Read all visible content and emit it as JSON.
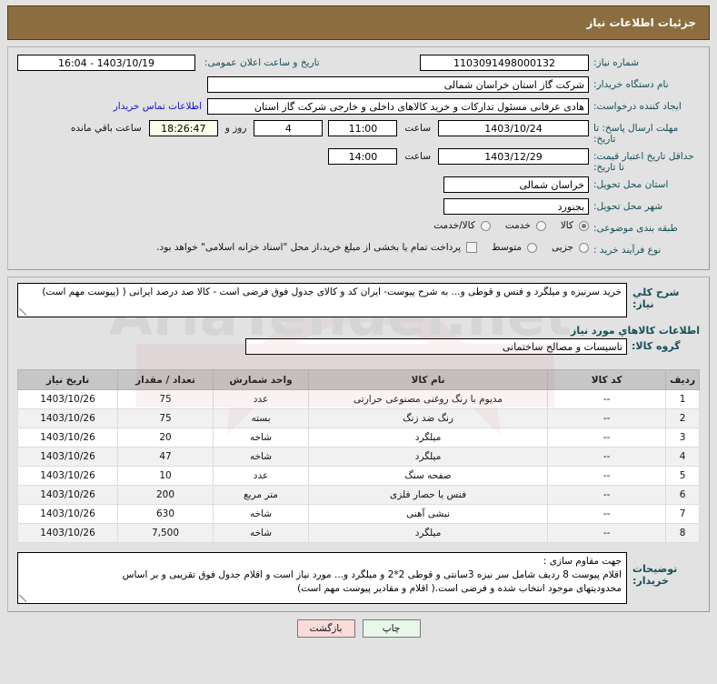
{
  "header": {
    "title": "جزئیات اطلاعات نیاز"
  },
  "form": {
    "need_number": {
      "label": "شماره نیاز:",
      "value": "1103091498000132"
    },
    "public_announce": {
      "label": "تاریخ و ساعت اعلان عمومی:",
      "value": "1403/10/19 - 16:04"
    },
    "buyer_org": {
      "label": "نام دستگاه خریدار:",
      "value": "شرکت گاز استان خراسان شمالی"
    },
    "requester": {
      "label": "ایجاد کننده درخواست:",
      "value": "هادی عرفانی مسئول تدارکات و خرید کالاهای داخلی و خارجی شرکت گاز استان",
      "contact_link": "اطلاعات تماس خریدار"
    },
    "response_deadline": {
      "label": "مهلت ارسال پاسخ: تا تاریخ:",
      "date": "1403/10/24",
      "time_label": "ساعت",
      "time": "11:00",
      "days_remaining": "4",
      "days_label": "روز و",
      "clock_remaining": "18:26:47",
      "remaining_label": "ساعت باقي مانده"
    },
    "price_validity": {
      "label": "حداقل تاریخ اعتبار قیمت: تا تاریخ:",
      "date": "1403/12/29",
      "time_label": "ساعت",
      "time": "14:00"
    },
    "delivery_province": {
      "label": "استان محل تحویل:",
      "value": "خراسان شمالی"
    },
    "delivery_city": {
      "label": "شهر محل تحویل:",
      "value": "بجنورد"
    },
    "subject_category": {
      "label": "طبقه بندی موضوعی:",
      "options": [
        "کالا",
        "خدمت",
        "کالا/خدمت"
      ],
      "selected": "کالا"
    },
    "purchase_process": {
      "label": "نوع فرآیند خرید :",
      "options": [
        "جزیی",
        "متوسط"
      ],
      "selected": "",
      "checkbox_text": "پرداخت تمام یا بخشی از مبلغ خرید،از محل \"اسناد خزانه اسلامی\" خواهد بود.",
      "checkbox_checked": false
    }
  },
  "need_summary": {
    "label": "شرح کلي نیاز:",
    "value": "خرید سرنیزه و میلگرد  و فنس و قوطی و... به شرح پیوست- ایران  کد و کالای جدول فوق فرضی  است - کالا صد درصد ایرانی ( (پیوست مهم است)"
  },
  "goods_section": {
    "title": "اطلاعات کالاهاي مورد نیاز",
    "group_label": "گروه کالا:",
    "group_value": "تاسیسات و مصالح ساختمانی"
  },
  "table": {
    "columns": [
      "ردیف",
      "کد کالا",
      "نام کالا",
      "واحد شمارش",
      "تعداد / مقدار",
      "تاریخ نیاز"
    ],
    "rows": [
      {
        "row": "1",
        "code": "--",
        "name": "مدیوم با رنگ روغنی مصنوعی حرارتی",
        "unit": "عدد",
        "qty": "75",
        "date": "1403/10/26"
      },
      {
        "row": "2",
        "code": "--",
        "name": "رنگ ضد زنگ",
        "unit": "بسته",
        "qty": "75",
        "date": "1403/10/26"
      },
      {
        "row": "3",
        "code": "--",
        "name": "میلگرد",
        "unit": "شاخه",
        "qty": "20",
        "date": "1403/10/26"
      },
      {
        "row": "4",
        "code": "--",
        "name": "میلگرد",
        "unit": "شاخه",
        "qty": "47",
        "date": "1403/10/26"
      },
      {
        "row": "5",
        "code": "--",
        "name": "صفحه سنگ",
        "unit": "عدد",
        "qty": "10",
        "date": "1403/10/26"
      },
      {
        "row": "6",
        "code": "--",
        "name": "فنس یا حصار فلزی",
        "unit": "متر مربع",
        "qty": "200",
        "date": "1403/10/26"
      },
      {
        "row": "7",
        "code": "--",
        "name": "نبشی آهنی",
        "unit": "شاخه",
        "qty": "630",
        "date": "1403/10/26"
      },
      {
        "row": "8",
        "code": "--",
        "name": "میلگرد",
        "unit": "شاخه",
        "qty": "7,500",
        "date": "1403/10/26"
      }
    ]
  },
  "buyer_notes": {
    "label": "توضیحات خریدار:",
    "line1": "جهت مقاوم سازی :",
    "line2": "اقلام پیوست 8 ردیف شامل سر نیزه 3سانتی و قوطی 2*2 و میلگرد و... مورد نیاز است و اقلام جدول فوق تقریبی و بر اساس",
    "line3": "محدودیتهای موجود انتخاب شده و فرضی است.( اقلام و مقادیر پیوست مهم است)"
  },
  "buttons": {
    "print": "چاپ",
    "back": "بازگشت"
  },
  "watermark": {
    "text": "AriaTender.net"
  },
  "colors": {
    "header_bg": "#8d6e41",
    "label": "#14505a",
    "link": "#1313d6",
    "table_header": "#c6c6c6",
    "print_btn": "#e8f7e8",
    "back_btn": "#fbdada"
  }
}
